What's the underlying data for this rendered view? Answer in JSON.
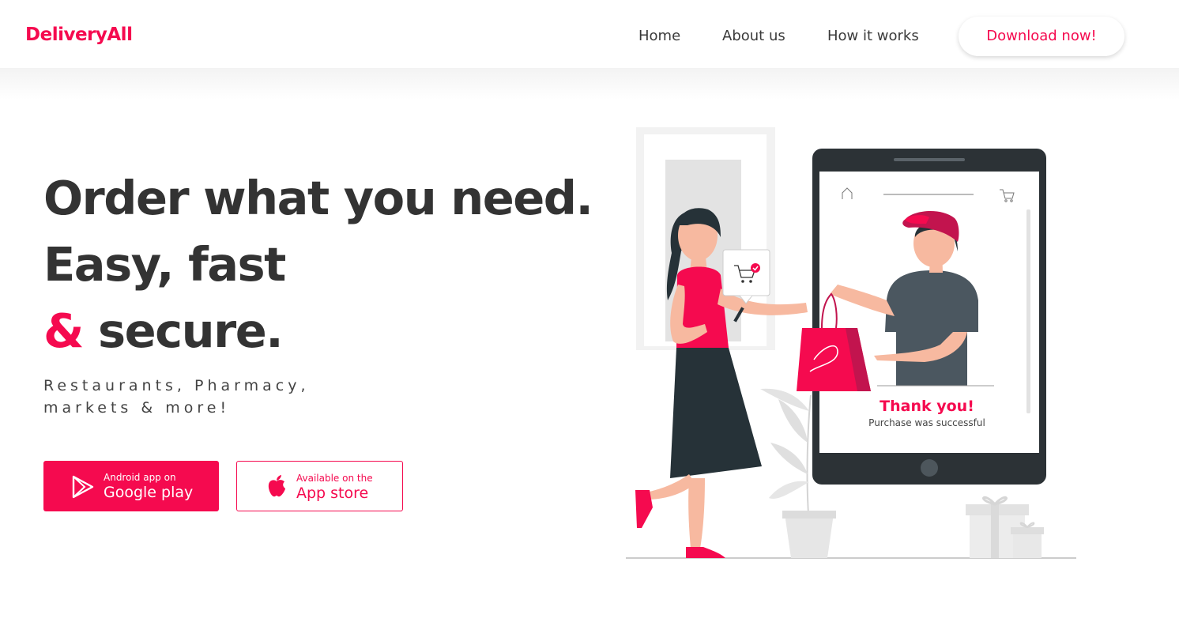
{
  "nav": {
    "logo": "DeliveryAll",
    "links": [
      "Home",
      "About us",
      "How it works"
    ],
    "download_label": "Download now!"
  },
  "hero": {
    "line1": "Order what you need.",
    "line2": "Easy, fast",
    "line3_amp": "&",
    "line3_rest": " secure.",
    "sub1": "Restaurants, Pharmacy,",
    "sub2": "markets & more!"
  },
  "stores": {
    "google_small": "Android app on",
    "google_big": "Google play",
    "apple_small": "Available on the",
    "apple_big": "App store"
  },
  "illustration": {
    "thank_title": "Thank you!",
    "thank_sub": "Purchase was successful"
  },
  "colors": {
    "accent": "#f50a4f",
    "text_dark": "#333333",
    "tablet": "#2c3236"
  },
  "icons": [
    "play-store-icon",
    "apple-icon",
    "home-icon",
    "cart-icon",
    "check-icon"
  ]
}
